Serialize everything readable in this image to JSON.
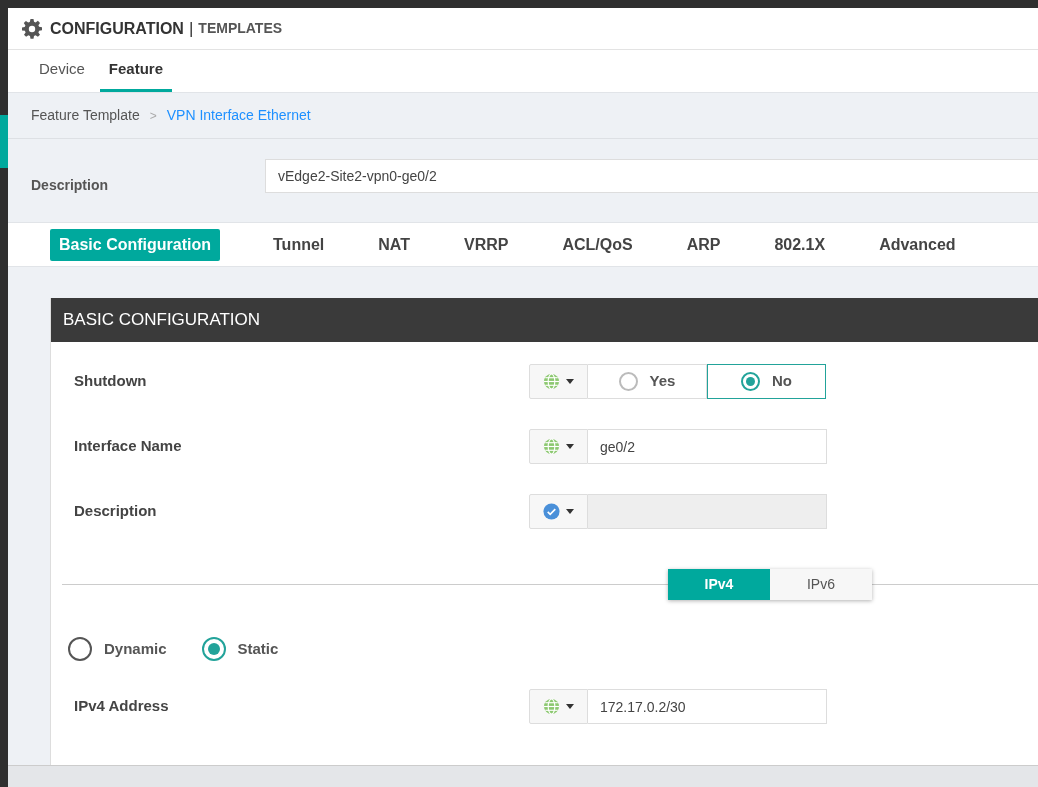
{
  "header": {
    "title": "CONFIGURATION",
    "separator": "|",
    "subtitle": "TEMPLATES"
  },
  "tabs": [
    {
      "label": "Device",
      "selected": false
    },
    {
      "label": "Feature",
      "selected": true
    }
  ],
  "breadcrumb": {
    "items": [
      {
        "label": "Feature Template",
        "current": false
      },
      {
        "label": "VPN Interface Ethernet",
        "current": true
      }
    ],
    "separator": ">"
  },
  "description": {
    "label": "Description",
    "value": "vEdge2-Site2-vpn0-ge0/2"
  },
  "section_tabs": [
    {
      "label": "Basic Configuration",
      "selected": true
    },
    {
      "label": "Tunnel",
      "selected": false
    },
    {
      "label": "NAT",
      "selected": false
    },
    {
      "label": "VRRP",
      "selected": false
    },
    {
      "label": "ACL/QoS",
      "selected": false
    },
    {
      "label": "ARP",
      "selected": false
    },
    {
      "label": "802.1X",
      "selected": false
    },
    {
      "label": "Advanced",
      "selected": false
    }
  ],
  "section": {
    "title": "BASIC CONFIGURATION",
    "fields": [
      {
        "kind": "radio",
        "label": "Shutdown",
        "default_value": false,
        "options": [
          {
            "label": "Yes",
            "selected": false
          },
          {
            "label": "No",
            "selected": true
          }
        ]
      },
      {
        "kind": "text",
        "label": "Interface Name",
        "default_value": false,
        "value": "ge0/2",
        "disabled": false
      },
      {
        "kind": "text",
        "label": "Description",
        "default_value": true,
        "disabled": true
      }
    ],
    "ip_toggle": [
      {
        "label": "IPv4",
        "selected": true
      },
      {
        "label": "IPv6",
        "selected": false
      }
    ],
    "address_mode": [
      {
        "label": "Dynamic",
        "selected": false
      },
      {
        "label": "Static",
        "selected": true
      }
    ],
    "address_fields": [
      {
        "kind": "text",
        "label": "IPv4 Address",
        "default_value": false,
        "value": "172.17.0.2/30",
        "disabled": false
      }
    ]
  }
}
